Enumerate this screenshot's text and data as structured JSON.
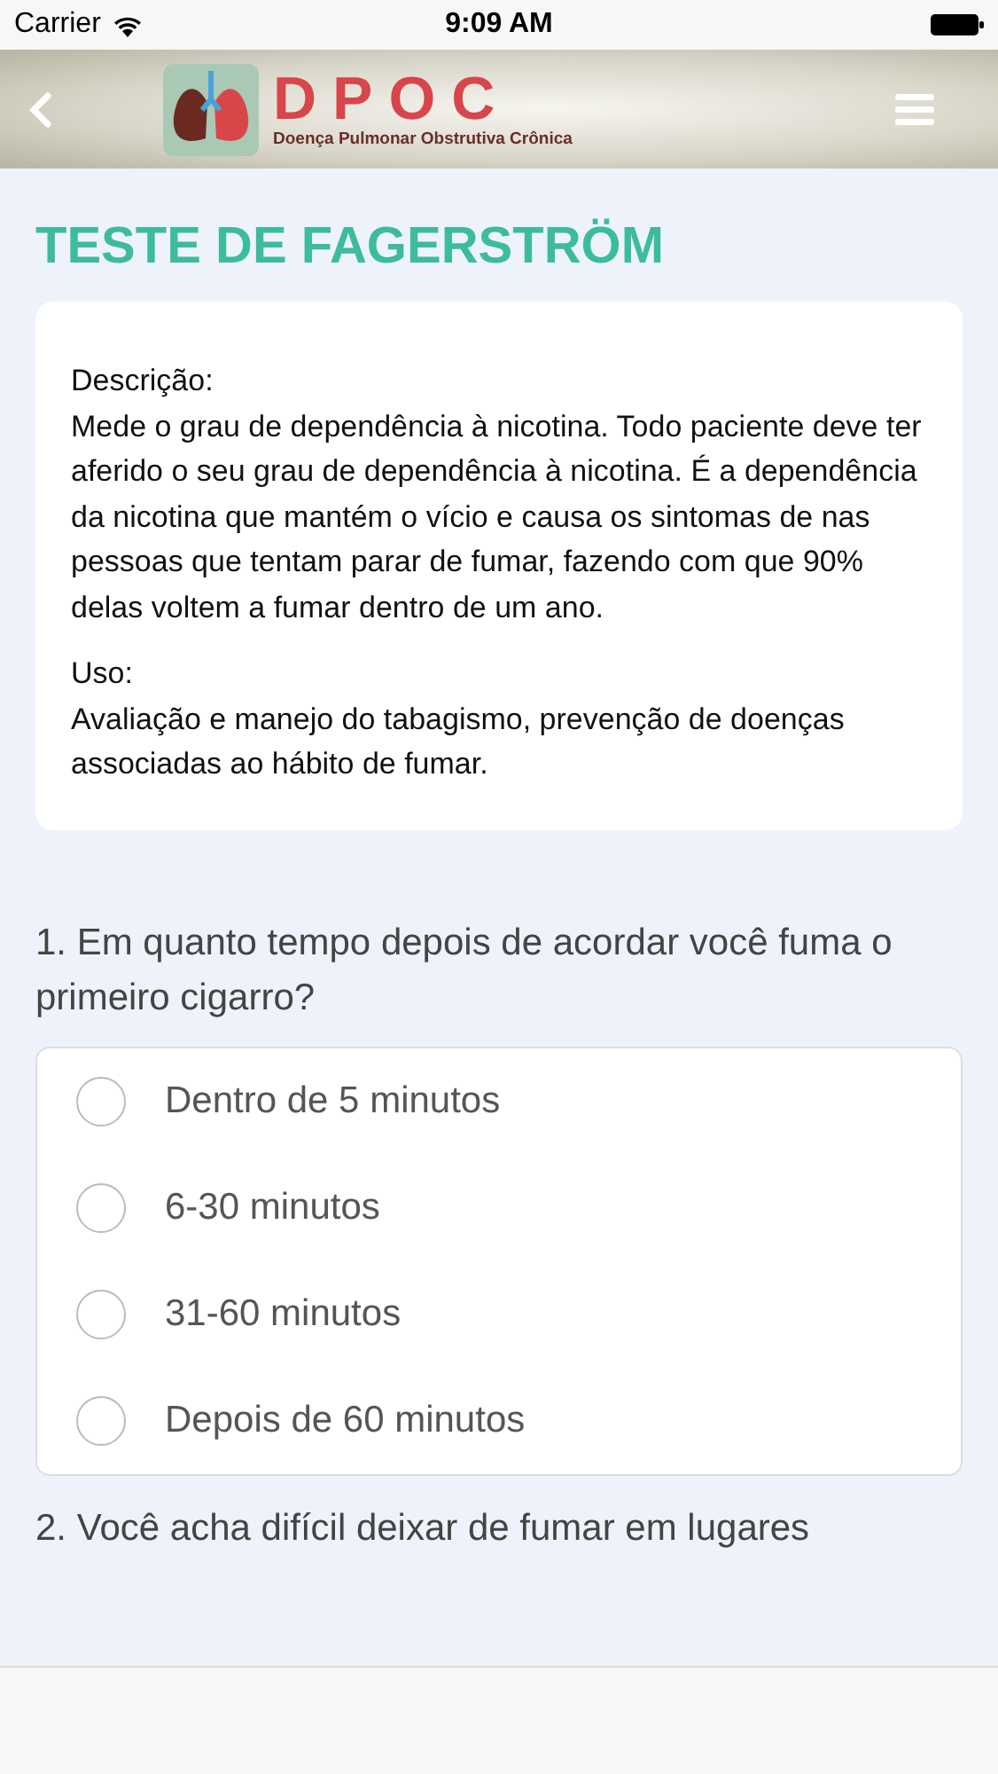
{
  "status_bar": {
    "carrier": "Carrier",
    "time": "9:09 AM"
  },
  "header": {
    "logo_title": "DPOC",
    "logo_subtitle": "Doença Pulmonar Obstrutiva Crônica"
  },
  "title": "TESTE DE FAGERSTRÖM",
  "info": [
    {
      "label": "Descrição:",
      "text": "Mede o grau de dependência à nicotina. Todo paciente deve ter aferido o seu grau de dependência à nicotina. É a dependência da nicotina que mantém o vício e causa os sintomas de nas pessoas que tentam parar de fumar, fazendo com que 90% delas voltem a fumar dentro de um ano."
    },
    {
      "label": "Uso:",
      "text": "Avaliação e manejo do tabagismo, prevenção de doenças associadas ao hábito de fumar."
    }
  ],
  "questions": [
    {
      "text": "1. Em quanto tempo depois de acordar você fuma o primeiro cigarro?",
      "options": [
        {
          "label": "Dentro de 5 minutos",
          "selected": false
        },
        {
          "label": "6-30 minutos",
          "selected": false
        },
        {
          "label": "31-60 minutos",
          "selected": false
        },
        {
          "label": "Depois de 60 minutos",
          "selected": false
        }
      ]
    },
    {
      "text": "2. Você acha difícil deixar de fumar em lugares"
    }
  ]
}
